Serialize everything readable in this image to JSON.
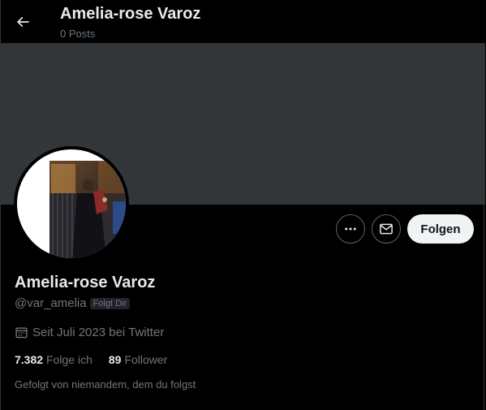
{
  "header": {
    "title": "Amelia-rose Varoz",
    "subtitle": "0 Posts"
  },
  "profile": {
    "display_name": "Amelia-rose Varoz",
    "handle": "@var_amelia",
    "follows_you_badge": "Folgt Dir",
    "joined": "Seit Juli 2023 bei Twitter",
    "following_count": "7.382",
    "following_label": "Folge ich",
    "followers_count": "89",
    "followers_label": "Follower",
    "followed_by": "Gefolgt von niemandem, dem du folgst"
  },
  "actions": {
    "follow_label": "Folgen"
  },
  "icons": {
    "back": "arrow-left-icon",
    "more": "more-icon",
    "message": "envelope-icon",
    "joined": "calendar-icon"
  },
  "colors": {
    "background": "#000000",
    "banner": "#333639",
    "primary_text": "#e7e9ea",
    "secondary_text": "#71767b",
    "follow_button_bg": "#eff3f4",
    "follow_button_text": "#0f1419"
  }
}
